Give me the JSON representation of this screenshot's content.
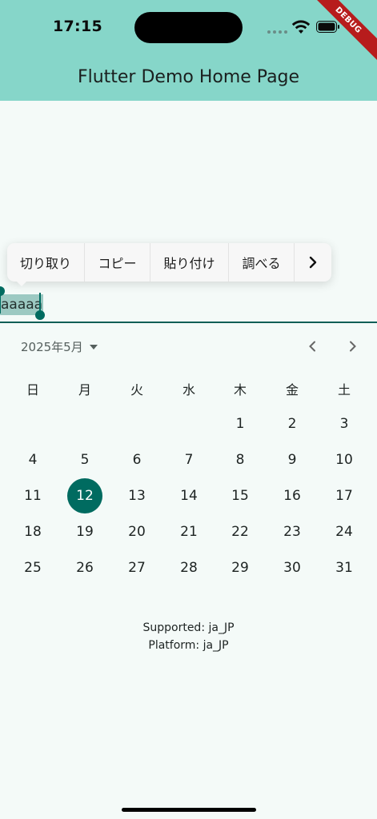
{
  "status_bar": {
    "time": "17:15",
    "debug_banner": "DEBUG"
  },
  "app_bar": {
    "title": "Flutter Demo Home Page"
  },
  "colors": {
    "app_bar": "#86d6c9",
    "accent": "#006b60",
    "background": "#f4faf8"
  },
  "selection_toolbar": {
    "items": [
      {
        "label": "切り取り"
      },
      {
        "label": "コピー"
      },
      {
        "label": "貼り付け"
      },
      {
        "label": "調べる"
      }
    ],
    "more_icon": "chevron-right-icon"
  },
  "text_field": {
    "value": "aaaaa",
    "selected": true
  },
  "calendar": {
    "month_label": "2025年5月",
    "weekdays": [
      "日",
      "月",
      "火",
      "水",
      "木",
      "金",
      "土"
    ],
    "weeks": [
      [
        "",
        "",
        "",
        "",
        "1",
        "2",
        "3"
      ],
      [
        "4",
        "5",
        "6",
        "7",
        "8",
        "9",
        "10"
      ],
      [
        "11",
        "12",
        "13",
        "14",
        "15",
        "16",
        "17"
      ],
      [
        "18",
        "19",
        "20",
        "21",
        "22",
        "23",
        "24"
      ],
      [
        "25",
        "26",
        "27",
        "28",
        "29",
        "30",
        "31"
      ]
    ],
    "selected_day": "12"
  },
  "info": {
    "supported": "Supported: ja_JP",
    "platform": "Platform: ja_JP"
  }
}
